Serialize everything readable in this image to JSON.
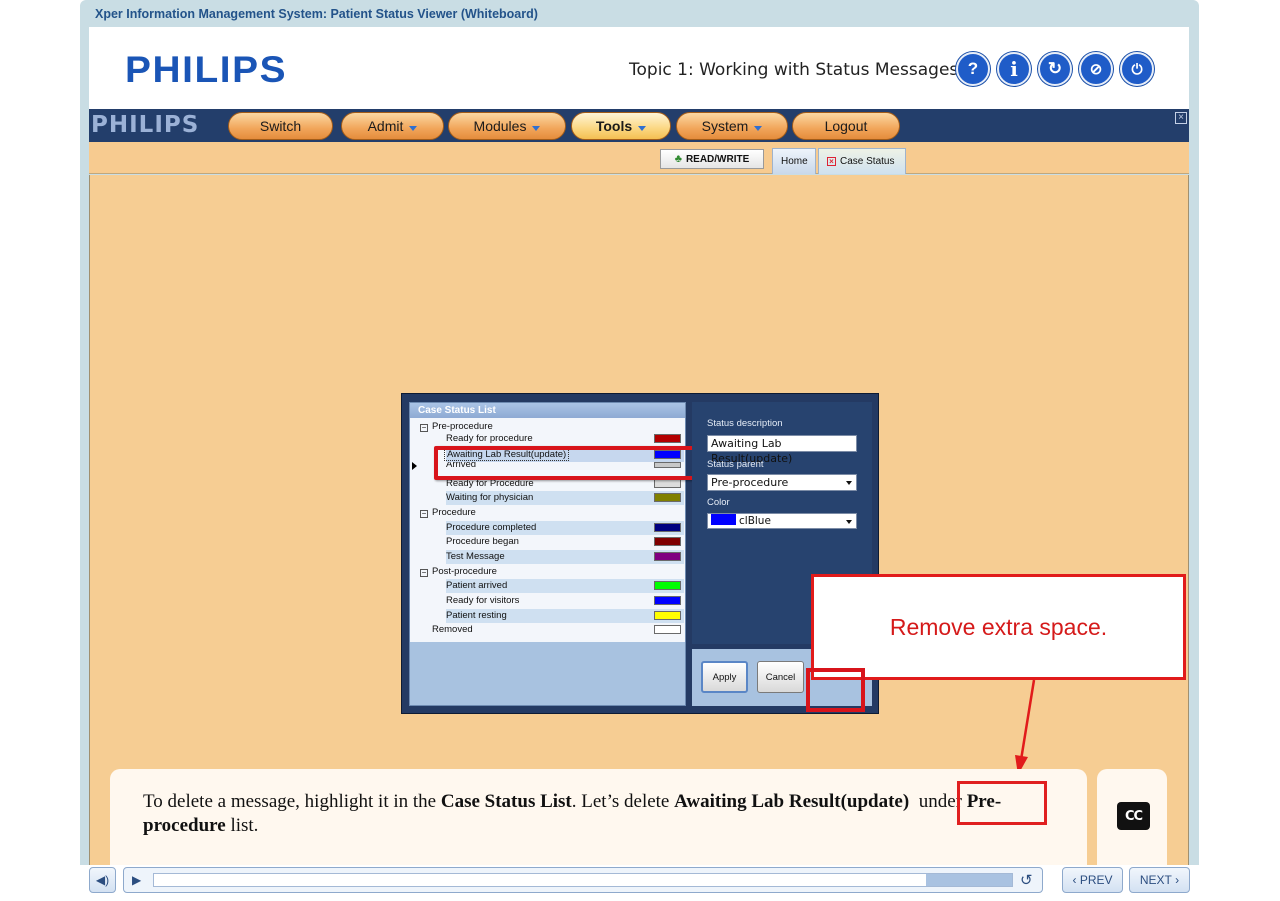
{
  "window_title": "Xper Information Management System: Patient Status Viewer (Whiteboard)",
  "header": {
    "logo": "PHILIPS",
    "topic": "Topic 1: Working with Status Messages",
    "buttons": [
      {
        "name": "help-button",
        "icon": "question-icon",
        "glyph": "?"
      },
      {
        "name": "info-button",
        "icon": "info-icon",
        "glyph": "i"
      },
      {
        "name": "replay-button",
        "icon": "refresh-icon",
        "glyph": "↻"
      },
      {
        "name": "navigate-button",
        "icon": "compass-icon",
        "glyph": "⊘"
      },
      {
        "name": "exit-button",
        "icon": "power-icon",
        "glyph": "⏻"
      }
    ]
  },
  "menubar": {
    "logo": "PHILIPS",
    "items": [
      {
        "label": "Switch",
        "dropdown": false
      },
      {
        "label": "Admit",
        "dropdown": true
      },
      {
        "label": "Modules",
        "dropdown": true
      },
      {
        "label": "Tools",
        "dropdown": true,
        "active": true
      },
      {
        "label": "System",
        "dropdown": true
      },
      {
        "label": "Logout",
        "dropdown": false
      }
    ]
  },
  "subbar": {
    "readwrite_label": "READ/WRITE",
    "tabs": [
      {
        "label": "Home"
      },
      {
        "label": "Case Status"
      }
    ]
  },
  "dialog": {
    "list_title": "Case Status List",
    "groups": [
      {
        "label": "Pre-procedure",
        "items": [
          {
            "label": "Ready for procedure",
            "color": "#b30000"
          },
          {
            "label": "Awaiting Lab Result(update)",
            "color": "#0000ff",
            "selected": true
          },
          {
            "label": "Arrived",
            "color": "#c8c8c8"
          },
          {
            "label": "Ready for Procedure",
            "color": "#dcdcdc"
          },
          {
            "label": "Waiting for physician",
            "color": "#808000"
          }
        ]
      },
      {
        "label": "Procedure",
        "items": [
          {
            "label": "Procedure completed",
            "color": "#000080"
          },
          {
            "label": "Procedure began",
            "color": "#800000"
          },
          {
            "label": "Test Message",
            "color": "#800080"
          }
        ]
      },
      {
        "label": "Post-procedure",
        "items": [
          {
            "label": "Patient arrived",
            "color": "#00ff00"
          },
          {
            "label": "Ready for visitors",
            "color": "#0000ff"
          },
          {
            "label": "Patient resting",
            "color": "#ffff00"
          }
        ]
      },
      {
        "label": "Removed",
        "items": [],
        "color": "#ffffff"
      }
    ],
    "status_description_label": "Status description",
    "status_description_value": "Awaiting Lab Result(update)",
    "status_parent_label": "Status parent",
    "status_parent_value": "Pre-procedure",
    "color_label": "Color",
    "color_value": "clBlue",
    "color_swatch": "#0000ff",
    "apply_label": "Apply",
    "cancel_label": "Cancel"
  },
  "callout": {
    "text": "Remove extra space.",
    "color": "#e11b1b"
  },
  "caption": {
    "part1": "To delete a message, highlight it in the ",
    "bold1": "Case Status List",
    "part2": ". Let’s delete ",
    "bold2": "Awaiting Lab Result(update)",
    "part3": "  under ",
    "bold3": "Pre-procedure",
    "part4": " list."
  },
  "cc_label": "CC",
  "player": {
    "prev_label": "PREV",
    "next_label": "NEXT",
    "progress": 0.9
  },
  "colors": {
    "brand_blue": "#1a55b6",
    "menubar": "#233e6b",
    "content_bg": "#f6cd93",
    "accent_red": "#e11b1b"
  }
}
